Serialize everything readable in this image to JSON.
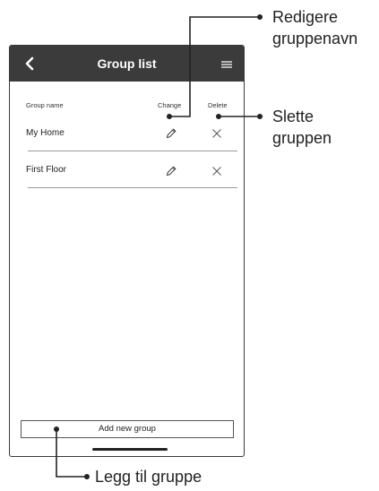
{
  "header": {
    "title": "Group list",
    "back_icon": "chevron-left-icon",
    "menu_icon": "hamburger-menu-icon",
    "bg_color": "#3b3b3b"
  },
  "columns": {
    "name": "Group name",
    "change": "Change",
    "delete": "Delete"
  },
  "groups": [
    {
      "name": "My Home",
      "edit_icon": "pencil-icon",
      "delete_icon": "close-icon"
    },
    {
      "name": "First Floor",
      "edit_icon": "pencil-icon",
      "delete_icon": "close-icon"
    }
  ],
  "add_button_label": "Add new group",
  "callouts": {
    "rename": "Redigere\ngruppenavn",
    "delete": "Slette\ngruppen",
    "add": "Legg til gruppe"
  }
}
